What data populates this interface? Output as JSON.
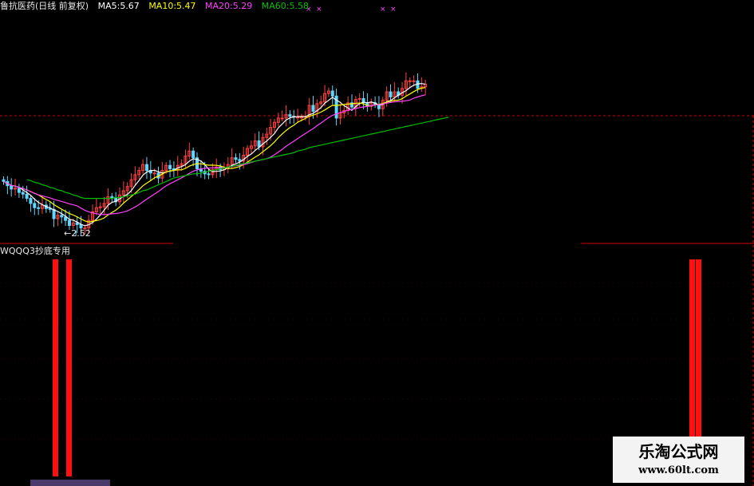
{
  "header": {
    "stock": "鲁抗医药(日线 前复权)",
    "ma5": "MA5:5.67",
    "ma10": "MA10:5.47",
    "ma20": "MA20:5.29",
    "ma60": "MA60:5.58"
  },
  "price_low_label": "←2.52",
  "indicator_title": "WQQQ3抄底专用",
  "watermark": {
    "title": "乐淘公式网",
    "url": "www.60lt.com"
  },
  "colors": {
    "background": "#000000",
    "up": "#ff4040",
    "down": "#5fd7ff",
    "ma5": "#ffffff",
    "ma10": "#ffff00",
    "ma20": "#ff40ff",
    "ma60": "#00c000",
    "signal": "#ff1010",
    "divider": "#d00000"
  },
  "icons": {
    "ma_marker": "double-cross-marker"
  },
  "chart_data": {
    "type": "candlestick",
    "price_closes": [
      5.06,
      5.01,
      4.97,
      4.98,
      4.93,
      4.91,
      4.86,
      4.8,
      4.75,
      4.74,
      4.78,
      4.74,
      4.73,
      4.62,
      4.66,
      4.64,
      4.6,
      4.54,
      4.57,
      4.55,
      4.51,
      4.51,
      4.6,
      4.7,
      4.75,
      4.76,
      4.8,
      4.88,
      4.87,
      4.82,
      4.9,
      4.95,
      5.0,
      5.08,
      5.14,
      5.19,
      5.26,
      5.19,
      5.16,
      5.16,
      5.1,
      5.19,
      5.25,
      5.21,
      5.2,
      5.25,
      5.27,
      5.36,
      5.42,
      5.34,
      5.21,
      5.18,
      5.15,
      5.14,
      5.2,
      5.23,
      5.2,
      5.22,
      5.26,
      5.34,
      5.32,
      5.3,
      5.37,
      5.45,
      5.48,
      5.54,
      5.47,
      5.58,
      5.62,
      5.7,
      5.76,
      5.81,
      5.81,
      5.85,
      5.83,
      5.82,
      5.82,
      5.82,
      5.83,
      5.96,
      5.89,
      5.98,
      6.0,
      6.1,
      6.13,
      6.07,
      5.81,
      5.87,
      5.9,
      5.99,
      5.94,
      6.03,
      6.04,
      5.99,
      5.95,
      5.99,
      5.97,
      5.92,
      6.02,
      6.12,
      6.06,
      6.12,
      6.08,
      6.16,
      6.25,
      6.25,
      6.25,
      6.16,
      6.18,
      6.21
    ],
    "price_low": 2.52,
    "ma60": [
      5.08,
      5.07,
      5.05,
      5.04,
      5.02,
      5.01,
      4.99,
      4.98,
      4.96,
      4.95,
      4.93,
      4.92,
      4.9,
      4.89,
      4.87,
      4.86,
      4.86,
      4.86,
      4.86,
      4.86,
      4.86,
      4.86,
      4.86,
      4.87,
      4.87,
      4.88,
      4.89,
      4.9,
      4.91,
      4.93,
      4.95,
      4.96,
      4.98,
      5.0,
      5.02,
      5.04,
      5.06,
      5.08,
      5.1,
      5.11,
      5.12,
      5.13,
      5.14,
      5.15,
      5.15,
      5.16,
      5.17,
      5.18,
      5.19,
      5.2,
      5.21,
      5.22,
      5.23,
      5.24,
      5.25,
      5.26,
      5.27,
      5.28,
      5.29,
      5.3,
      5.31,
      5.32,
      5.33,
      5.34,
      5.35,
      5.36,
      5.37,
      5.38,
      5.39,
      5.4,
      5.42,
      5.43,
      5.44,
      5.46,
      5.47,
      5.48,
      5.49,
      5.5,
      5.51,
      5.52,
      5.53,
      5.54,
      5.55,
      5.56,
      5.57,
      5.58,
      5.59,
      5.6,
      5.61,
      5.62,
      5.63,
      5.64,
      5.65,
      5.66,
      5.67,
      5.68,
      5.69,
      5.7,
      5.71,
      5.72,
      5.73,
      5.74,
      5.75,
      5.76,
      5.77,
      5.78,
      5.79,
      5.8,
      5.81,
      5.82
    ],
    "ma60_start_index": 6,
    "signal_bars": [
      13,
      16,
      166,
      168
    ]
  }
}
